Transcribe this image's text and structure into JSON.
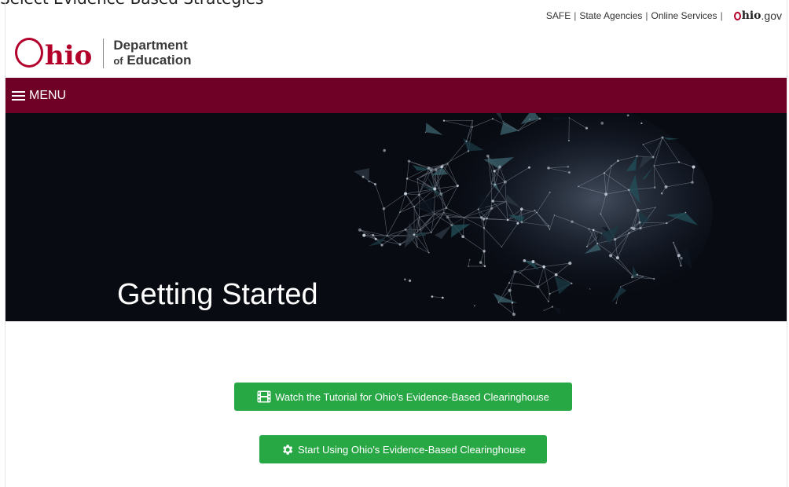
{
  "document": {
    "heading": "Select Evidence-Based Strategies"
  },
  "utility_nav": {
    "links": [
      "SAFE",
      "State Agencies",
      "Online Services"
    ],
    "separator": "|",
    "ohio_gov_logo": {
      "hio": "hio",
      "gov": ".gov"
    }
  },
  "brand": {
    "logo_hio": "hio",
    "dept_line1": "Department",
    "dept_of": "of",
    "dept_line2": "Education",
    "logo_color": "#b2002a"
  },
  "menu": {
    "label": "MENU",
    "icon": "hamburger-icon",
    "bar_color": "#6f0026"
  },
  "hero": {
    "title": "Getting Started"
  },
  "actions": {
    "tutorial": {
      "label": "Watch the Tutorial for Ohio's Evidence-Based Clearinghouse",
      "icon": "film-icon"
    },
    "start": {
      "label": "Start Using Ohio's Evidence-Based Clearinghouse",
      "icon": "gear-icon"
    },
    "button_color": "#28a745"
  }
}
